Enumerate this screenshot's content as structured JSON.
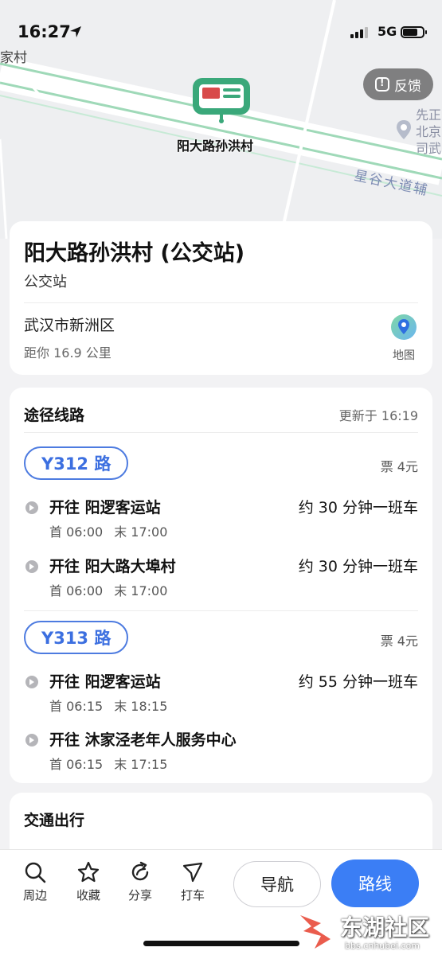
{
  "status_bar": {
    "time": "16:27",
    "network": "5G"
  },
  "map": {
    "label_topleft": "家村",
    "feedback_label": "反馈",
    "stop_label": "阳大路孙洪村",
    "poi_text": "先正北京司武",
    "road_name": "星谷大道辅"
  },
  "info": {
    "title": "阳大路孙洪村 (公交站)",
    "type": "公交站",
    "district": "武汉市新洲区",
    "distance": "距你 16.9 公里",
    "map_button": "地图"
  },
  "routes": {
    "heading": "途径线路",
    "updated": "更新于 16:19",
    "lines": [
      {
        "name": "Y312 路",
        "fare": "票 4元",
        "directions": [
          {
            "to": "开往 阳逻客运站",
            "freq": "约 30 分钟一班车",
            "first": "首 06:00",
            "last": "末 17:00"
          },
          {
            "to": "开往 阳大路大埠村",
            "freq": "约 30 分钟一班车",
            "first": "首 06:00",
            "last": "末 17:00"
          }
        ]
      },
      {
        "name": "Y313 路",
        "fare": "票 4元",
        "directions": [
          {
            "to": "开往 阳逻客运站",
            "freq": "约 55 分钟一班车",
            "first": "首 06:15",
            "last": "末 18:15"
          },
          {
            "to": "开往 沐家泾老年人服务中心",
            "freq": "",
            "first": "首 06:15",
            "last": "末 17:15"
          }
        ]
      }
    ]
  },
  "transit": {
    "heading": "交通出行"
  },
  "toolbar": {
    "nearby": "周边",
    "favorite": "收藏",
    "share": "分享",
    "taxi": "打车",
    "navigate": "导航",
    "route": "路线"
  },
  "watermark": {
    "main": "东湖社区",
    "sub": "bbs.cnhubei.com"
  },
  "colors": {
    "accent": "#3b7ef5",
    "route_badge": "#4d7be0",
    "map_road": "#9fd9b8"
  }
}
